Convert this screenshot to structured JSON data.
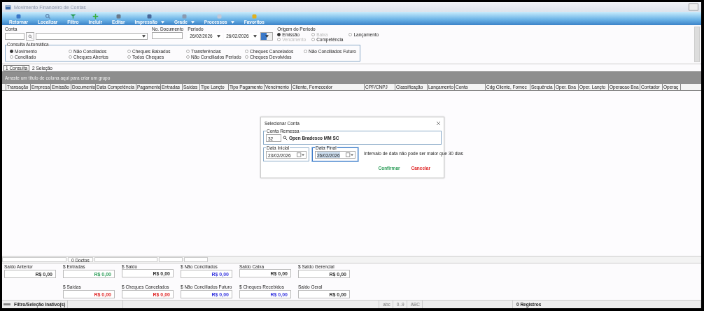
{
  "window": {
    "title": "Movimento Financeiro de Contas"
  },
  "toolbar": [
    {
      "label": "Retornar",
      "dropdown": false
    },
    {
      "label": "Localizar",
      "dropdown": false
    },
    {
      "label": "Filtro",
      "dropdown": false
    },
    {
      "label": "Incluir",
      "dropdown": false
    },
    {
      "label": "Editar",
      "dropdown": false
    },
    {
      "label": "Impressão",
      "dropdown": true
    },
    {
      "label": "Grade",
      "dropdown": true
    },
    {
      "label": "Processos",
      "dropdown": true
    },
    {
      "label": "Favoritos",
      "dropdown": false
    }
  ],
  "filters": {
    "conta_label": "Conta",
    "documento_label": "No. Documento",
    "periodo_label": "Periodo",
    "periodo_inicio": "26/02/2026",
    "periodo_fim": "26/02/2026",
    "origem": {
      "label": "Origem do Periodo",
      "options": [
        {
          "label": "Emissão",
          "selected": true,
          "disabled": false
        },
        {
          "label": "Baixa",
          "selected": false,
          "disabled": true
        },
        {
          "label": "Lançamento",
          "selected": false,
          "disabled": false
        },
        {
          "label": "Vencimento",
          "selected": false,
          "disabled": true
        },
        {
          "label": "Competência",
          "selected": false,
          "disabled": false
        }
      ]
    }
  },
  "consulta": {
    "label": "Consulta Automática",
    "options": [
      {
        "label": "Movimento",
        "selected": true
      },
      {
        "label": "Conciliado",
        "selected": false
      },
      {
        "label": "Não Conciliados",
        "selected": false
      },
      {
        "label": "Cheques Abertos",
        "selected": false
      },
      {
        "label": "Cheques Baixados",
        "selected": false
      },
      {
        "label": "Todos Cheques",
        "selected": false
      },
      {
        "label": "Transferências",
        "selected": false
      },
      {
        "label": "Não Conciliados Periodo",
        "selected": false
      },
      {
        "label": "Cheques Cancelados",
        "selected": false
      },
      {
        "label": "Cheques Devolvidos",
        "selected": false
      },
      {
        "label": "Não Conciliados Futuro",
        "selected": false
      }
    ]
  },
  "tabs": [
    {
      "label": "1 Consulta",
      "selected": true
    },
    {
      "label": "2 Seleção",
      "selected": false
    }
  ],
  "group_panel": "Arraste um título de coluna aqui para criar um grupo",
  "table": {
    "columns": [
      "Transação",
      "Empresa",
      "Emissão",
      "Documento",
      "Data Competência",
      "Pagamento",
      "Entradas",
      "Saídas",
      "Tipo Lançto",
      "Tipo Pagamento",
      "Vencimento",
      "Cliente, Fornecedor",
      "CPF/CNPJ",
      "Classificação",
      "Lançamento",
      "Conta",
      "Cdg Cliente, Fornec",
      "Sequência",
      "Oper. Bxa",
      "Oper. Lançto",
      "Operacao Bxa",
      "Contador",
      "Operaç"
    ]
  },
  "dialog": {
    "title": "Selecionar Conta",
    "conta_label": "Conta Remessa",
    "conta_code": "32",
    "conta_name": "Open Bradesco MM SC",
    "data_inicial_label": "Data Inicial",
    "data_inicial": "23/02/2026",
    "data_final_label": "Data Final",
    "data_final": "26/02/2026",
    "message": "Intervalo de data não pode ser maior que 30 dias",
    "confirm": "Confirmar",
    "cancel": "Cancelar"
  },
  "footer": {
    "doc_count": "0 Doctos"
  },
  "totals": [
    {
      "label": "Saldo Anterior",
      "value": "R$ 0,00"
    },
    {
      "label": "$ Entradas",
      "value": "R$ 0,00",
      "color": "#2e9e5a"
    },
    {
      "label": "$ Saldo",
      "value": "R$ 0,00"
    },
    {
      "label": "$ Não Conciliados",
      "value": "R$ 0,00",
      "color": "#3a3ae0"
    },
    {
      "label": "Saldo Caixa",
      "value": "R$ 0,00"
    },
    {
      "label": "$ Saldo Gerencial",
      "value": "R$ 0,00"
    },
    {
      "label": "$ Saídas",
      "value": "R$ 0,00",
      "color": "#e02a2a"
    },
    {
      "label": "$ Cheques Cancelados",
      "value": "R$ 0,00",
      "color": "#e02a2a"
    },
    {
      "label": "$ Não Conciliados Futuro",
      "value": "R$ 0,00",
      "color": "#3a3ae0"
    },
    {
      "label": "$ Cheques Recebidos",
      "value": "R$ 0,00",
      "color": "#3a3ae0"
    },
    {
      "label": "Saldo Geral",
      "value": "R$ 0,00"
    }
  ],
  "status_bar": {
    "filter": "Filtro/Seleção Inativo(s)",
    "mode_1": "abc",
    "mode_2": "0..9",
    "mode_3": "ABC",
    "records": "0 Registros"
  }
}
